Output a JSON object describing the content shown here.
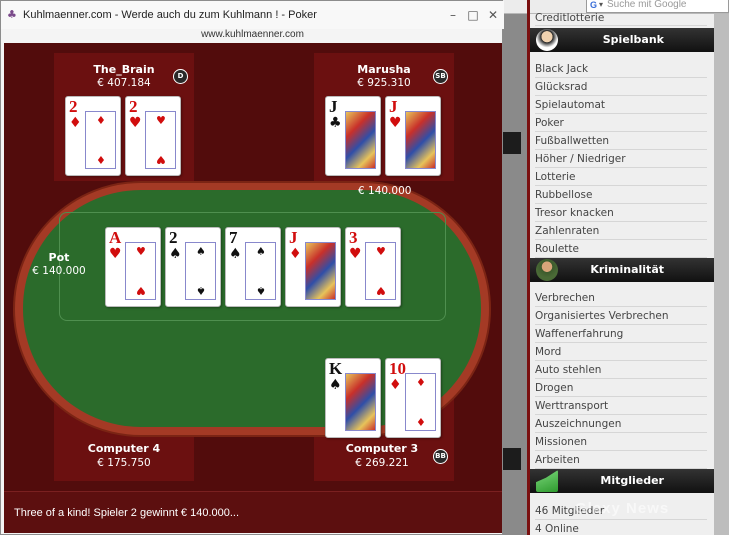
{
  "window": {
    "title": "Kuhlmaenner.com - Werde auch du zum Kuhlmann ! - Poker",
    "url": "www.kuhlmaenner.com",
    "controls": {
      "minimize": "–",
      "maximize": "□",
      "close": "✕"
    }
  },
  "browser": {
    "search_placeholder": "Suche mit Google"
  },
  "site_menu": {
    "top_item": "Creditlotterie",
    "sections": [
      {
        "header": "Spielbank",
        "icon": "dealer-icon",
        "items": [
          "Black Jack",
          "Glücksrad",
          "Spielautomat",
          "Poker",
          "Fußballwetten",
          "Höher / Niedriger",
          "Lotterie",
          "Rubbellose",
          "Tresor knacken",
          "Zahlenraten",
          "Roulette"
        ]
      },
      {
        "header": "Kriminalität",
        "icon": "gangster-icon",
        "items": [
          "Verbrechen",
          "Organisiertes Verbrechen",
          "Waffenerfahrung",
          "Mord",
          "Auto stehlen",
          "Drogen",
          "Werttransport",
          "Auszeichnungen",
          "Missionen",
          "Arbeiten"
        ]
      },
      {
        "header": "Mitglieder",
        "icon": "members-chart-icon",
        "items": [
          "46 Mitglieder",
          "4 Online"
        ]
      }
    ],
    "watermark": "Glaxy News"
  },
  "players": {
    "top_left": {
      "name": "The_Brain",
      "chips": "€ 407.184",
      "marker": "D",
      "cards": [
        {
          "rank": "2",
          "suit": "♦",
          "color": "red"
        },
        {
          "rank": "2",
          "suit": "♥",
          "color": "red"
        }
      ]
    },
    "top_right": {
      "name": "Marusha",
      "chips": "€ 925.310",
      "marker": "SB",
      "bet": "€ 140.000",
      "cards": [
        {
          "rank": "J",
          "suit": "♣",
          "color": "black"
        },
        {
          "rank": "J",
          "suit": "♥",
          "color": "red"
        }
      ]
    },
    "bottom_left": {
      "name": "Computer 4",
      "chips": "€ 175.750"
    },
    "bottom_right": {
      "name": "Computer 3",
      "chips": "€ 269.221",
      "marker": "BB",
      "cards": [
        {
          "rank": "K",
          "suit": "♠",
          "color": "black"
        },
        {
          "rank": "10",
          "suit": "♦",
          "color": "red"
        }
      ]
    }
  },
  "pot": {
    "label": "Pot",
    "value": "€ 140.000"
  },
  "board": [
    {
      "rank": "A",
      "suit": "♥",
      "color": "red"
    },
    {
      "rank": "2",
      "suit": "♠",
      "color": "black"
    },
    {
      "rank": "7",
      "suit": "♠",
      "color": "black"
    },
    {
      "rank": "J",
      "suit": "♦",
      "color": "red"
    },
    {
      "rank": "3",
      "suit": "♥",
      "color": "red"
    }
  ],
  "status": "Three of a kind! Spieler 2 gewinnt € 140.000..."
}
